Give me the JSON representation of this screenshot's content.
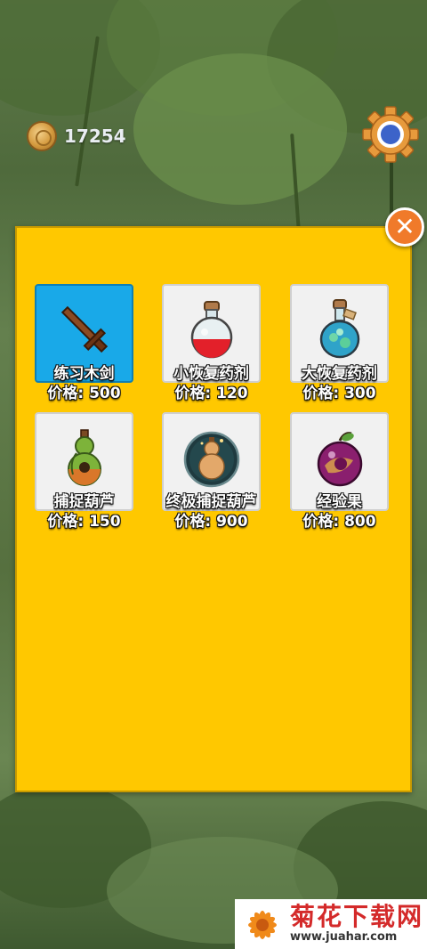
{
  "hud": {
    "coins": "17254",
    "coin_icon": "gold-coin-icon",
    "settings_icon": "gear-icon"
  },
  "shop": {
    "close_icon": "close-x-icon",
    "items": [
      {
        "name": "练习木剑",
        "price": "价格: 500",
        "icon": "wooden-sword-icon",
        "selected": true
      },
      {
        "name": "小恢复药剂",
        "price": "价格: 120",
        "icon": "red-potion-icon",
        "selected": false
      },
      {
        "name": "大恢复药剂",
        "price": "价格: 300",
        "icon": "blue-potion-icon",
        "selected": false
      },
      {
        "name": "捕捉葫芦",
        "price": "价格: 150",
        "icon": "capture-gourd-icon",
        "selected": false
      },
      {
        "name": "终极捕捉葫芦",
        "price": "价格: 900",
        "icon": "ultimate-gourd-icon",
        "selected": false
      },
      {
        "name": "经验果",
        "price": "价格: 800",
        "icon": "exp-fruit-icon",
        "selected": false
      }
    ]
  },
  "watermark": {
    "title": "菊花下载网",
    "url": "www.juahar.com"
  },
  "colors": {
    "panel": "#ffc800",
    "selected_card": "#19a9e8",
    "close_button": "#f07a2a",
    "watermark_text": "#d42a2a"
  }
}
